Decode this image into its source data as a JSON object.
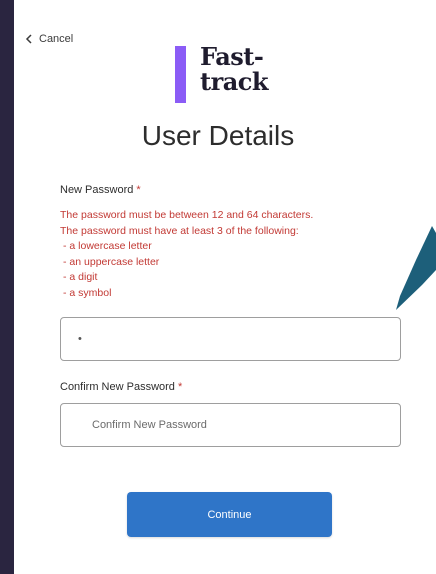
{
  "nav": {
    "cancel_label": "Cancel"
  },
  "brand": {
    "line1": "Fast-",
    "line2": "track",
    "accent_color": "#8b5cf6"
  },
  "page": {
    "title": "User Details"
  },
  "new_password": {
    "label": "New Password",
    "required_mark": "*",
    "value": "•",
    "rules": [
      "The password must be between 12 and 64 characters.",
      "The password must have at least 3 of the following:",
      "- a lowercase letter",
      "- an uppercase letter",
      "- a digit",
      "- a symbol"
    ]
  },
  "confirm_password": {
    "label": "Confirm New Password",
    "required_mark": "*",
    "placeholder": "Confirm New Password"
  },
  "actions": {
    "continue_label": "Continue",
    "button_color": "#2f75c8"
  },
  "colors": {
    "error": "#c23934",
    "callout": "#1d5f7a"
  }
}
